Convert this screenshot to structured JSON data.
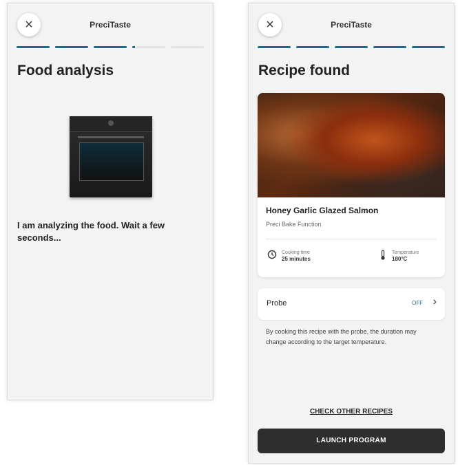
{
  "left_screen": {
    "app_title": "PreciTaste",
    "close_icon": "×",
    "progress_total": 5,
    "progress_done": 3,
    "progress_partial": 1,
    "title": "Food analysis",
    "image_alt": "oven",
    "message": "I am analyzing the food. Wait a few seconds..."
  },
  "right_screen": {
    "app_title": "PreciTaste",
    "close_icon": "×",
    "progress_total": 5,
    "progress_done": 5,
    "title": "Recipe found",
    "recipe": {
      "name": "Honey Garlic Glazed Salmon",
      "function": "Preci Bake Function",
      "cooking_time_label": "Cooking time",
      "cooking_time_value": "25 minutes",
      "temperature_label": "Temperature",
      "temperature_value": "180°C"
    },
    "probe": {
      "label": "Probe",
      "status": "OFF",
      "chevron": "›"
    },
    "probe_note": "By cooking this recipe with the probe, the duration may change according to the target temperature.",
    "check_other_label": "CHECK OTHER RECIPES",
    "launch_label": "LAUNCH PROGRAM"
  },
  "colors": {
    "accent": "#1c6b87",
    "button_dark": "#2e2e2e",
    "screen_bg": "#f3f3f3"
  },
  "icons": {
    "close": "close-icon",
    "clock": "clock-icon",
    "thermometer": "thermometer-icon",
    "chevron": "chevron-right-icon"
  }
}
